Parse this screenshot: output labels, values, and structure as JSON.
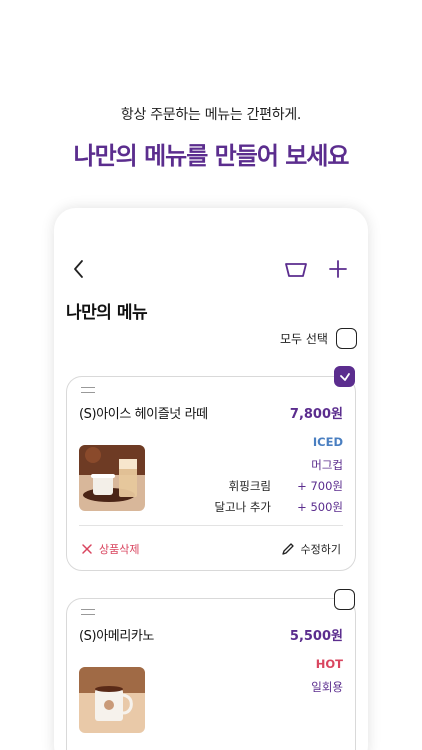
{
  "promo": {
    "subtitle": "항상 주문하는 메뉴는 간편하게.",
    "title": "나만의 메뉴를 만들어 보세요"
  },
  "header": {
    "back_icon": "chevron-left-icon",
    "basket_icon": "basket-icon",
    "add_icon": "plus-icon"
  },
  "page": {
    "title": "나만의 메뉴",
    "select_all_label": "모두 선택"
  },
  "items": [
    {
      "name": "(S)아이스 헤이즐넛 라떼",
      "price": "7,800원",
      "temperature": "ICED",
      "cup": "머그컵",
      "options": [
        {
          "label": "휘핑크림",
          "price": "+ 700원"
        },
        {
          "label": "달고나 추가",
          "price": "+ 500원"
        }
      ],
      "delete_label": "상품삭제",
      "edit_label": "수정하기",
      "checked": true
    },
    {
      "name": "(S)아메리카노",
      "price": "5,500원",
      "temperature": "HOT",
      "cup": "일회용",
      "options": [],
      "checked": false
    }
  ],
  "colors": {
    "brand_purple": "#5b2d8e",
    "iced_blue": "#4a7fc1",
    "hot_red": "#d9455f"
  }
}
